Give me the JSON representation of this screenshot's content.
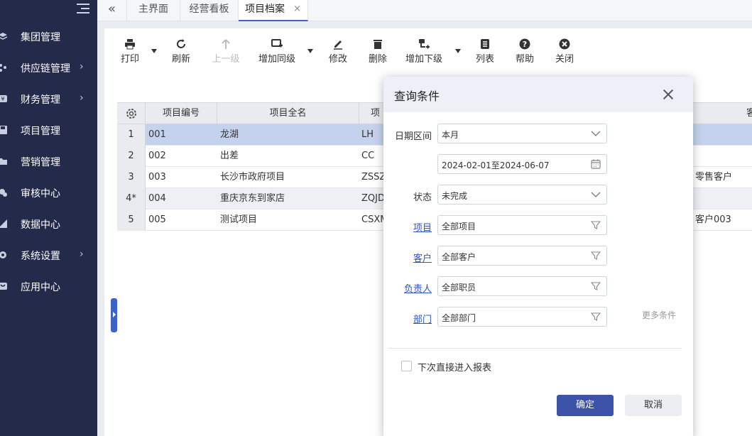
{
  "sidebar": {
    "items": [
      {
        "label": "集团管理",
        "icon": "layers-icon",
        "has_arrow": false
      },
      {
        "label": "供应链管理",
        "icon": "supply-chain-icon",
        "has_arrow": true
      },
      {
        "label": "财务管理",
        "icon": "finance-icon",
        "has_arrow": true
      },
      {
        "label": "项目管理",
        "icon": "save-icon",
        "has_arrow": false
      },
      {
        "label": "营销管理",
        "icon": "folder-icon",
        "has_arrow": false
      },
      {
        "label": "审核中心",
        "icon": "audit-icon",
        "has_arrow": false
      },
      {
        "label": "数据中心",
        "icon": "chart-icon",
        "has_arrow": false
      },
      {
        "label": "系统设置",
        "icon": "settings-icon",
        "has_arrow": true
      },
      {
        "label": "应用中心",
        "icon": "app-icon",
        "has_arrow": false
      }
    ],
    "arrow": "›"
  },
  "tabs": {
    "back": "«",
    "items": [
      {
        "label": "主界面",
        "active": false
      },
      {
        "label": "经营看板",
        "active": false
      },
      {
        "label": "项目档案",
        "active": true,
        "close": "×"
      }
    ]
  },
  "toolbar": {
    "print": "打印",
    "refresh": "刷新",
    "up_level": "上一级",
    "add_same_level": "增加同级",
    "edit": "修改",
    "delete": "删除",
    "add_sub_level": "增加下级",
    "list": "列表",
    "help": "帮助",
    "close": "关闭"
  },
  "grid": {
    "columns": [
      "项目编号",
      "项目全名",
      "项",
      "客"
    ],
    "rows": [
      {
        "no": "1",
        "code": "001",
        "name": "龙湖",
        "short": "LH",
        "customer": "",
        "selected": true
      },
      {
        "no": "2",
        "code": "002",
        "name": "出差",
        "short": "CC",
        "customer": ""
      },
      {
        "no": "3",
        "code": "003",
        "name": "长沙市政府项目",
        "short": "ZSSZ",
        "customer": "零售客户"
      },
      {
        "no": "4*",
        "code": "004",
        "name": "重庆京东到家店",
        "short": "ZQJD",
        "customer": ""
      },
      {
        "no": "5",
        "code": "005",
        "name": "测试项目",
        "short": "CSXM",
        "customer": "客户003"
      }
    ]
  },
  "dialog": {
    "title": "查询条件",
    "fields": {
      "date_range_label": "日期区间",
      "date_range_value": "本月",
      "date_value": "2024-02-01至2024-06-07",
      "status_label": "状态",
      "status_value": "未完成",
      "project_label": "项目",
      "project_value": "全部项目",
      "customer_label": "客户",
      "customer_value": "全部客户",
      "owner_label": "负责人",
      "owner_value": "全部职员",
      "dept_label": "部门",
      "dept_value": "全部部门"
    },
    "more": "更多条件",
    "checkbox_label": "下次直接进入报表",
    "ok": "确定",
    "cancel": "取消"
  },
  "colors": {
    "sidebar_bg": "#232a4a",
    "accent": "#3d63c8",
    "ok_button": "#3d52a9",
    "selected_row": "#c5d2ee"
  }
}
